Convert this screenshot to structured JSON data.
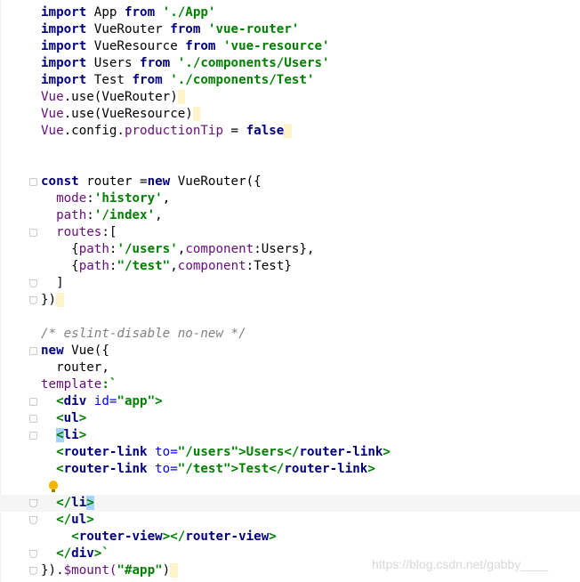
{
  "editor": {
    "lines": [
      [
        "import",
        " App ",
        "from",
        " './App'"
      ],
      [
        "import",
        " VueRouter ",
        "from",
        " 'vue-router'"
      ],
      [
        "import",
        " VueResource ",
        "from",
        " 'vue-resource'"
      ],
      [
        "import",
        " Users ",
        "from",
        " './components/Users'"
      ],
      [
        "import",
        " Test ",
        "from",
        " './components/Test'"
      ],
      [
        "Vue",
        ".use(VueRouter)"
      ],
      [
        "Vue",
        ".use(VueResource)"
      ],
      [
        "Vue",
        ".config.",
        "productionTip",
        " = ",
        "false"
      ],
      [],
      [],
      [
        "const",
        " router =",
        "new",
        " VueRouter({"
      ],
      [
        "  ",
        "mode",
        ":",
        "'history'",
        ","
      ],
      [
        "  ",
        "path",
        ":",
        "'/index'",
        ","
      ],
      [
        "  ",
        "routes",
        ":["
      ],
      [
        "    {",
        "path",
        ":",
        "'/users'",
        ",",
        "component",
        ":Users},"
      ],
      [
        "    {",
        "path",
        ":",
        "\"/test\"",
        ",",
        "component",
        ":Test}"
      ],
      [
        "  ]"
      ],
      [
        "})"
      ],
      [],
      [
        "/* eslint-disable no-new */"
      ],
      [
        "new",
        " Vue({"
      ],
      [
        "  router,"
      ],
      [
        "template",
        ":`"
      ],
      [
        "  <",
        "div",
        " id=",
        "\"app\"",
        ">"
      ],
      [
        "  <",
        "ul",
        ">"
      ],
      [
        "  ",
        "<",
        "li",
        ">"
      ],
      [
        "  <",
        "router-link",
        " to=",
        "\"/users\"",
        ">Users</",
        "router-link",
        ">"
      ],
      [
        "  <",
        "router-link",
        " to=",
        "\"/test\"",
        ">Test</",
        "router-link",
        ">"
      ],
      [],
      [
        "  </",
        "li",
        ">"
      ],
      [
        "  </",
        "ul",
        ">"
      ],
      [
        "    <",
        "router-view",
        "></",
        "router-view",
        ">"
      ],
      [
        "  </",
        "div",
        ">`"
      ],
      [
        "}).",
        "$mount(",
        "\"#app\"",
        ")"
      ]
    ]
  },
  "watermark": "https://blog.csdn.net/gabby____"
}
